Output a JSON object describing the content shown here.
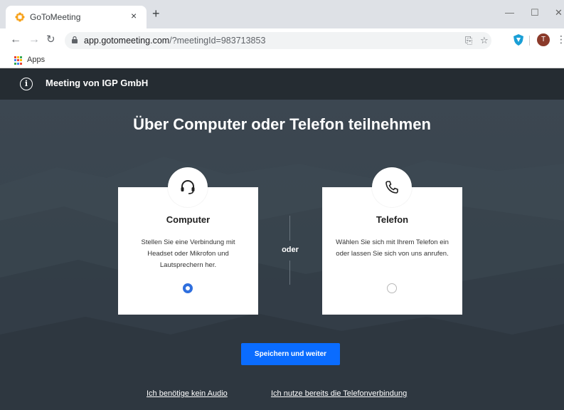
{
  "browser": {
    "tab_title": "GoToMeeting",
    "tab_close": "×",
    "new_tab": "+",
    "url_host": "app.gotomeeting.com",
    "url_path": "/?meetingId=983713853",
    "avatar_letter": "T",
    "bookmarks": {
      "apps_label": "Apps"
    },
    "icons": [
      "back-arrow-icon",
      "forward-arrow-icon",
      "reload-icon",
      "lock-icon",
      "translate-icon",
      "star-icon",
      "extension-icon",
      "menu-dots-icon",
      "minimize-icon",
      "maximize-icon",
      "close-icon"
    ]
  },
  "header": {
    "meeting_title": "Meeting von IGP GmbH"
  },
  "main": {
    "title": "Über Computer oder Telefon teilnehmen",
    "options": [
      {
        "title": "Computer",
        "description": "Stellen Sie eine Verbindung mit Headset oder Mikrofon und Lautsprechern her.",
        "icon": "headset-icon",
        "selected": true
      },
      {
        "title": "Telefon",
        "description": "Wählen Sie sich mit Ihrem Telefon ein oder lassen Sie sich von uns anrufen.",
        "icon": "phone-icon",
        "selected": false
      }
    ],
    "separator": "oder",
    "primary_button": "Speichern und weiter",
    "links": [
      "Ich benötige kein Audio",
      "Ich nutze bereits die Telefonverbindung"
    ]
  },
  "colors": {
    "accent": "#0a6cff",
    "header_bg": "#252c32",
    "main_bg": "#3a454f",
    "radio_selected": "#2f6fde"
  }
}
